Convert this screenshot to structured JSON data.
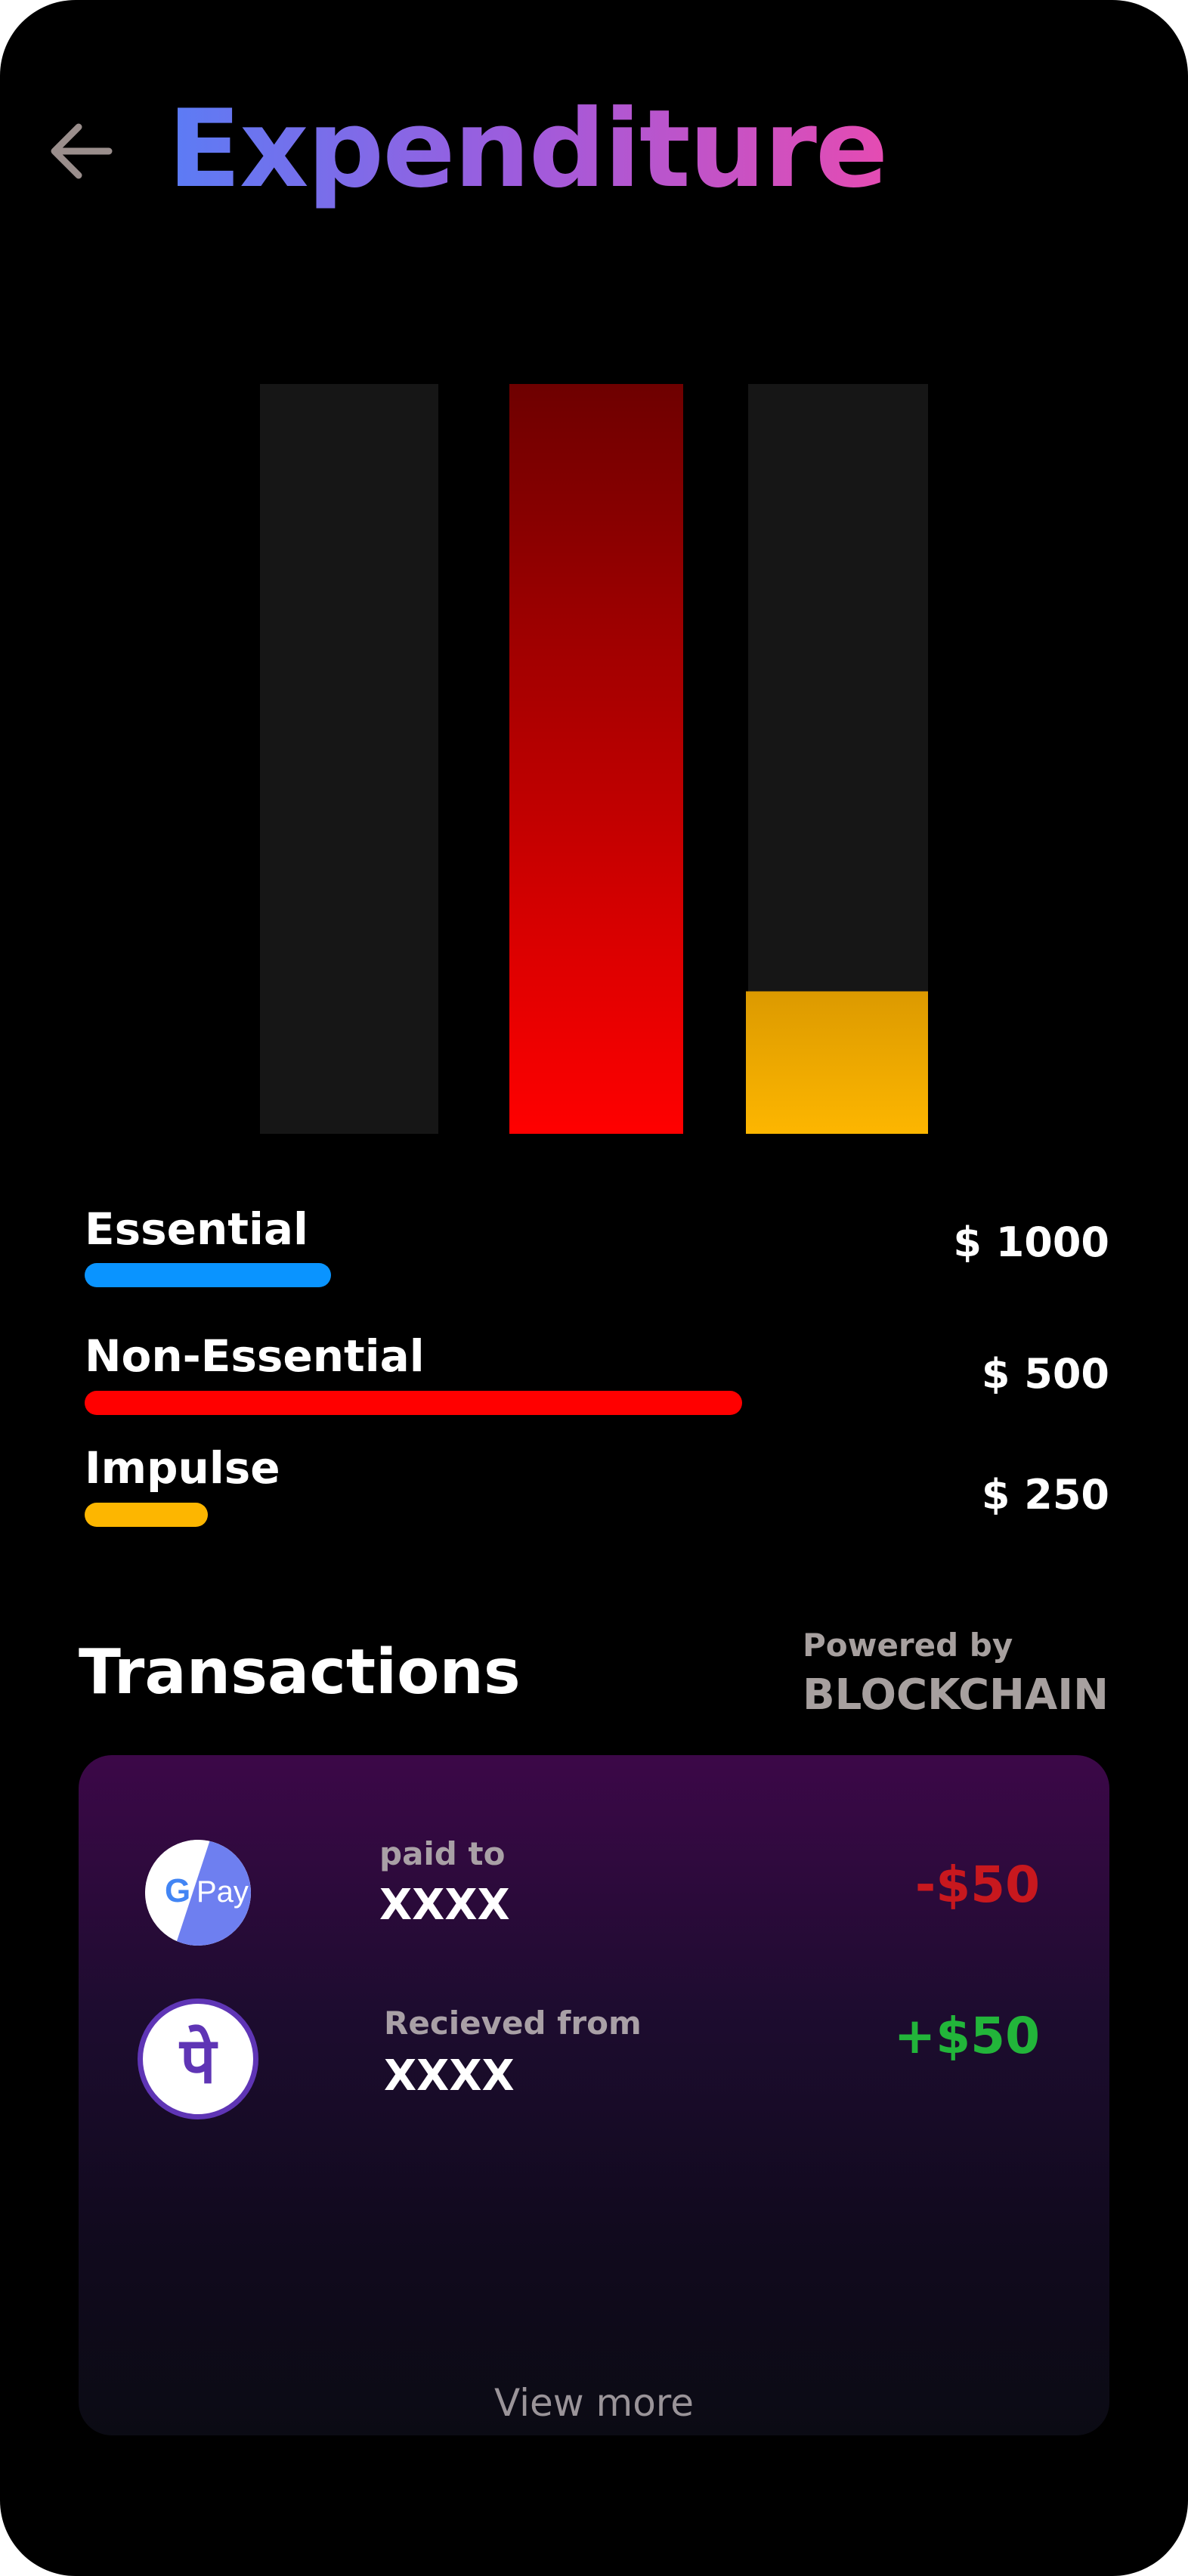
{
  "header": {
    "title": "Expenditure",
    "back_icon": "arrow-left-icon",
    "back_color": "#9a8e8c"
  },
  "chart_data": {
    "type": "bar",
    "categories": [
      "Essential",
      "Non-Essential",
      "Impulse"
    ],
    "fill_fraction": [
      0,
      1,
      0.19
    ],
    "track_color": "#161616",
    "fill_colors": [
      [
        "#0a94ff",
        "#0a94ff"
      ],
      [
        "#6e0000",
        "#ff0000"
      ],
      [
        "#dc9a00",
        "#fdb600"
      ]
    ]
  },
  "legend": [
    {
      "label": "Essential",
      "amount": "$ 1000",
      "color": "#0a94ff",
      "bar_fraction": 0.24
    },
    {
      "label": "Non-Essential",
      "amount": "$ 500",
      "color": "#ff0000",
      "bar_fraction": 0.64
    },
    {
      "label": "Impulse",
      "amount": "$ 250",
      "color": "#fdb600",
      "bar_fraction": 0.12
    }
  ],
  "transactions": {
    "title": "Transactions",
    "powered_by": "Powered by",
    "provider": "BLOCKCHAIN",
    "items": [
      {
        "app_icon": "google-pay-icon",
        "direction_label": "paid to",
        "party": "XXXX",
        "amount": "-$50",
        "amount_color": "#c8181e"
      },
      {
        "app_icon": "phonepe-icon",
        "direction_label": "Recieved from",
        "party": "XXXX",
        "amount": "+$50",
        "amount_color": "#22b53a"
      }
    ],
    "view_more": "View more"
  },
  "icons": {
    "gpay_text": "Pay",
    "gpay_g": "G",
    "phonepe_glyph": "पे"
  }
}
